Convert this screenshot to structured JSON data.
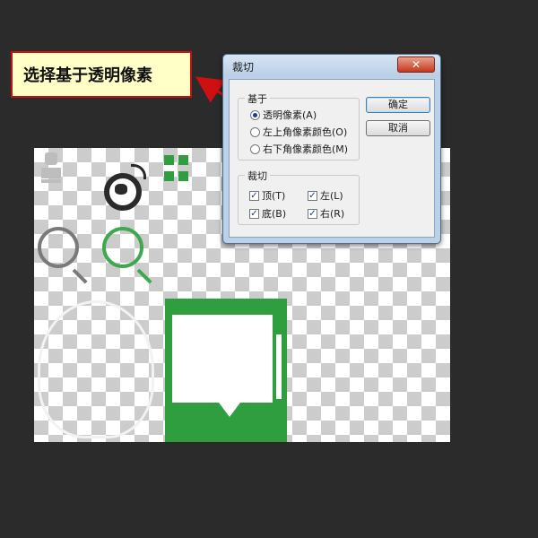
{
  "annotation": {
    "text": "选择基于透明像素"
  },
  "dialog": {
    "title": "裁切",
    "close_label": "✕",
    "based_on": {
      "title": "基于",
      "options": [
        {
          "label": "透明像素(A)",
          "checked": true
        },
        {
          "label": "左上角像素颜色(O)",
          "checked": false
        },
        {
          "label": "右下角像素颜色(M)",
          "checked": false
        }
      ]
    },
    "trim_away": {
      "title": "裁切",
      "top": {
        "label": "顶(T)",
        "checked": true
      },
      "left": {
        "label": "左(L)",
        "checked": true
      },
      "bottom": {
        "label": "底(B)",
        "checked": true
      },
      "right": {
        "label": "右(R)",
        "checked": true
      }
    },
    "ok_label": "确定",
    "cancel_label": "取消"
  },
  "colors": {
    "background": "#2b2b2b",
    "callout_fill": "#ffffc7",
    "callout_border": "#c11111",
    "sprite_green": "#2e9e3e"
  }
}
